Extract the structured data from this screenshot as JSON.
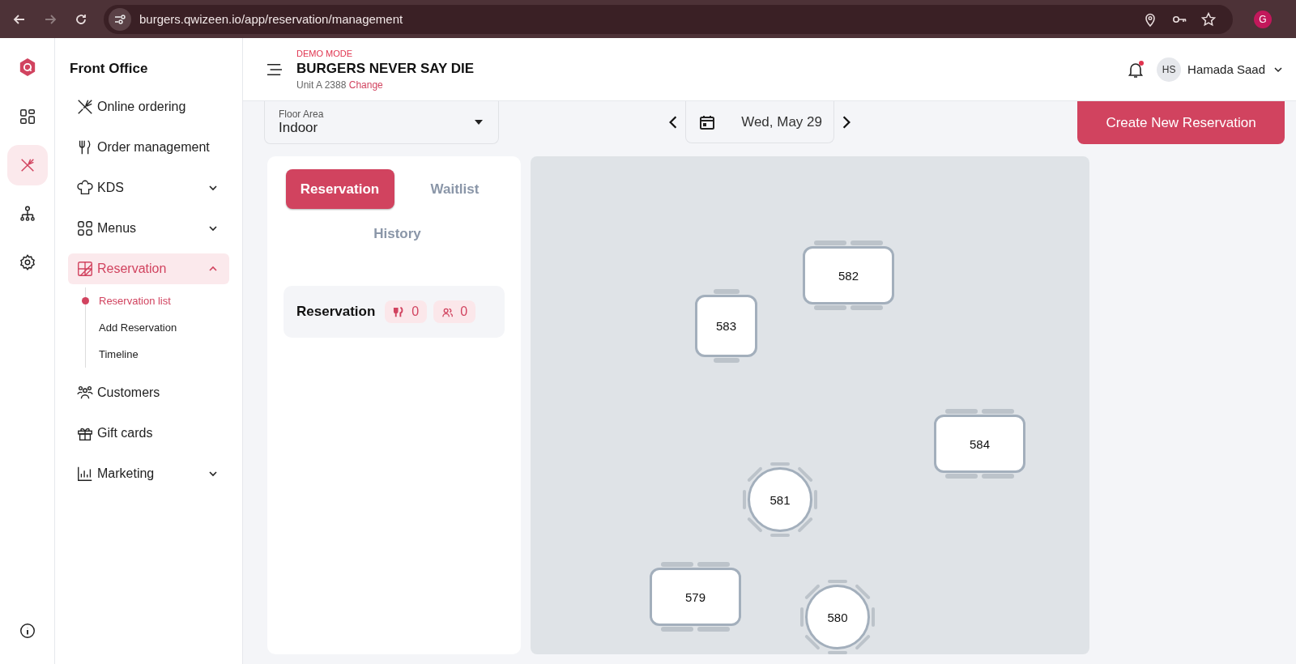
{
  "browser": {
    "url": "burgers.qwizeen.io/app/reservation/management",
    "profile": "G"
  },
  "rail": {
    "items": [
      {
        "selected": false
      },
      {
        "selected": true
      },
      {
        "selected": false
      },
      {
        "selected": false
      }
    ]
  },
  "sidebar": {
    "title": "Front Office",
    "items": [
      {
        "label": "Online ordering",
        "selected": false
      },
      {
        "label": "Order management",
        "selected": false
      },
      {
        "label": "KDS",
        "expanded": false,
        "selected": false
      },
      {
        "label": "Menus",
        "expanded": false,
        "selected": false
      },
      {
        "label": "Reservation",
        "expanded": true,
        "selected": true,
        "children": [
          {
            "label": "Reservation list",
            "selected": true
          },
          {
            "label": "Add Reservation",
            "selected": false
          },
          {
            "label": "Timeline",
            "selected": false
          }
        ]
      },
      {
        "label": "Customers",
        "selected": false
      },
      {
        "label": "Gift cards",
        "selected": false
      },
      {
        "label": "Marketing",
        "expanded": false,
        "selected": false
      }
    ]
  },
  "header": {
    "mode": "DEMO MODE",
    "restaurant": "BURGERS NEVER SAY DIE",
    "unit": "Unit A 2388",
    "change_link": "Change",
    "unread": true,
    "user": {
      "initials": "HS",
      "name": "Hamada Saad"
    }
  },
  "toolbar": {
    "floor_area": {
      "label": "Floor Area",
      "value": "Indoor"
    },
    "date": "Wed, May 29",
    "create_button": "Create New Reservation"
  },
  "tabs": [
    {
      "label": "Reservation",
      "selected": true
    },
    {
      "label": "Waitlist",
      "selected": false
    },
    {
      "label": "History",
      "selected": false
    }
  ],
  "summary": {
    "title": "Reservation",
    "tables": "0",
    "guests": "0"
  },
  "floor_plan": {
    "tables": [
      {
        "label": "582",
        "kind": "rect"
      },
      {
        "label": "583",
        "kind": "square"
      },
      {
        "label": "584",
        "kind": "rect"
      },
      {
        "label": "581",
        "kind": "round"
      },
      {
        "label": "579",
        "kind": "rect"
      },
      {
        "label": "580",
        "kind": "round"
      }
    ]
  }
}
